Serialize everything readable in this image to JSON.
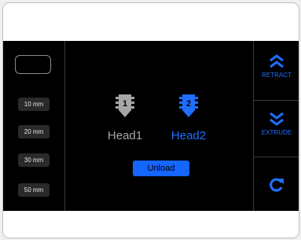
{
  "steps": [
    "10 mm",
    "20 mm",
    "30 mm",
    "50 mm"
  ],
  "heads": [
    {
      "label": "Head1",
      "number": "1",
      "color": "#a6a6a6",
      "selected": false
    },
    {
      "label": "Head2",
      "number": "2",
      "color": "#1f6fff",
      "selected": true
    }
  ],
  "actions": {
    "unload_label": "Unload",
    "retract_label": "RETRACT",
    "extrude_label": "EXTRUDE"
  },
  "colors": {
    "accent": "#1f6fff",
    "screen_bg": "#000000",
    "inactive": "#a6a6a6"
  },
  "icons": {
    "retract": "double-chevron-up-icon",
    "extrude": "double-chevron-down-icon",
    "refresh": "refresh-icon",
    "head": "extruder-head-icon"
  }
}
